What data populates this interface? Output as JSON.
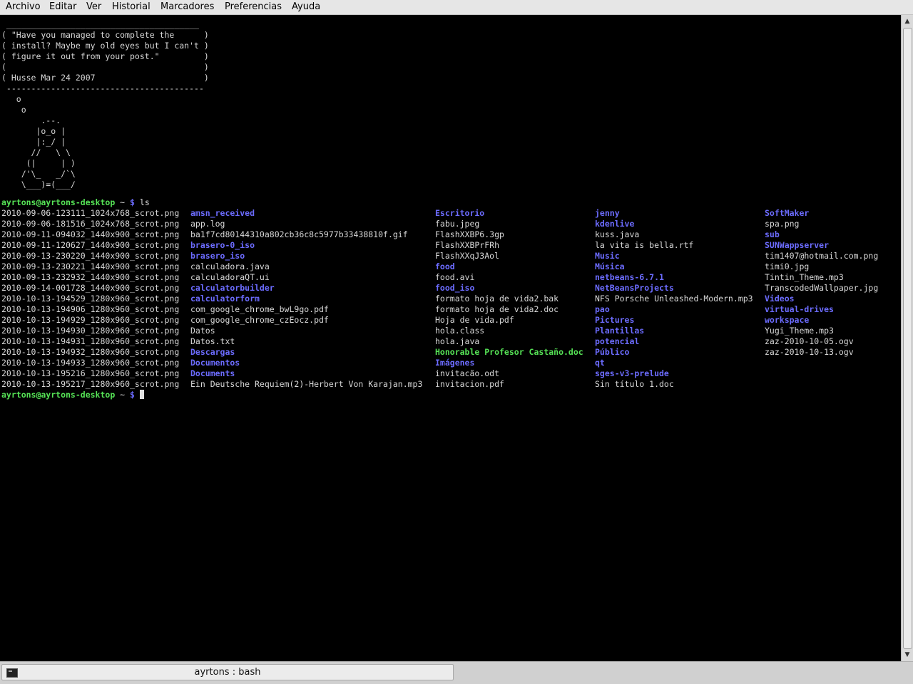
{
  "menubar": {
    "items": [
      "Archivo",
      "Editar",
      "Ver",
      "Historial",
      "Marcadores",
      "Preferencias",
      "Ayuda"
    ]
  },
  "terminal": {
    "cowsay_lines": [
      " _______________________________________",
      "( \"Have you managed to complete the      )",
      "( install? Maybe my old eyes but I can't )",
      "( figure it out from your post.\"         )",
      "(                                        )",
      "( Husse Mar 24 2007                      )",
      " ----------------------------------------",
      "   o",
      "    o",
      "        .--.",
      "       |o_o |",
      "       |:_/ |",
      "      //   \\ \\",
      "     (|     | )",
      "    /'\\_   _/`\\",
      "    \\___)=(___/"
    ],
    "prompt": {
      "user_host": "ayrtons@ayrtons-desktop",
      "path": " ~ ",
      "symbol": "$",
      "command": " ls"
    },
    "ls_columns": [
      [
        {
          "n": "2010-09-06-123111_1024x768_scrot.png",
          "t": "file"
        },
        {
          "n": "2010-09-06-181516_1024x768_scrot.png",
          "t": "file"
        },
        {
          "n": "2010-09-11-094032_1440x900_scrot.png",
          "t": "file"
        },
        {
          "n": "2010-09-11-120627_1440x900_scrot.png",
          "t": "file"
        },
        {
          "n": "2010-09-13-230220_1440x900_scrot.png",
          "t": "file"
        },
        {
          "n": "2010-09-13-230221_1440x900_scrot.png",
          "t": "file"
        },
        {
          "n": "2010-09-13-232932_1440x900_scrot.png",
          "t": "file"
        },
        {
          "n": "2010-09-14-001728_1440x900_scrot.png",
          "t": "file"
        },
        {
          "n": "2010-10-13-194529_1280x960_scrot.png",
          "t": "file"
        },
        {
          "n": "2010-10-13-194906_1280x960_scrot.png",
          "t": "file"
        },
        {
          "n": "2010-10-13-194929_1280x960_scrot.png",
          "t": "file"
        },
        {
          "n": "2010-10-13-194930_1280x960_scrot.png",
          "t": "file"
        },
        {
          "n": "2010-10-13-194931_1280x960_scrot.png",
          "t": "file"
        },
        {
          "n": "2010-10-13-194932_1280x960_scrot.png",
          "t": "file"
        },
        {
          "n": "2010-10-13-194933_1280x960_scrot.png",
          "t": "file"
        },
        {
          "n": "2010-10-13-195216_1280x960_scrot.png",
          "t": "file"
        },
        {
          "n": "2010-10-13-195217_1280x960_scrot.png",
          "t": "file"
        }
      ],
      [
        {
          "n": "amsn_received",
          "t": "dir"
        },
        {
          "n": "app.log",
          "t": "file"
        },
        {
          "n": "ba1f7cd80144310a802cb36c8c5977b33438810f.gif",
          "t": "file"
        },
        {
          "n": "brasero-0_iso",
          "t": "dir"
        },
        {
          "n": "brasero_iso",
          "t": "dir"
        },
        {
          "n": "calculadora.java",
          "t": "file"
        },
        {
          "n": "calculadoraQT.ui",
          "t": "file"
        },
        {
          "n": "calculatorbuilder",
          "t": "dir"
        },
        {
          "n": "calculatorform",
          "t": "dir"
        },
        {
          "n": "com_google_chrome_bwL9go.pdf",
          "t": "file"
        },
        {
          "n": "com_google_chrome_czEocz.pdf",
          "t": "file"
        },
        {
          "n": "Datos",
          "t": "file"
        },
        {
          "n": "Datos.txt",
          "t": "file"
        },
        {
          "n": "Descargas",
          "t": "dir"
        },
        {
          "n": "Documentos",
          "t": "dir"
        },
        {
          "n": "Documents",
          "t": "dir"
        },
        {
          "n": "Ein Deutsche Requiem(2)-Herbert Von Karajan.mp3",
          "t": "file"
        }
      ],
      [
        {
          "n": "Escritorio",
          "t": "dir"
        },
        {
          "n": "fabu.jpeg",
          "t": "file"
        },
        {
          "n": "FlashXXBP6.3gp",
          "t": "file"
        },
        {
          "n": "FlashXXBPrFRh",
          "t": "file"
        },
        {
          "n": "FlashXXqJ3Aol",
          "t": "file"
        },
        {
          "n": "food",
          "t": "dir"
        },
        {
          "n": "food.avi",
          "t": "file"
        },
        {
          "n": "food_iso",
          "t": "dir"
        },
        {
          "n": "formato hoja de vida2.bak",
          "t": "file"
        },
        {
          "n": "formato hoja de vida2.doc",
          "t": "file"
        },
        {
          "n": "Hoja de vida.pdf",
          "t": "file"
        },
        {
          "n": "hola.class",
          "t": "file"
        },
        {
          "n": "hola.java",
          "t": "file"
        },
        {
          "n": "Honorable Profesor Castaño.doc",
          "t": "exe"
        },
        {
          "n": "Imágenes",
          "t": "dir"
        },
        {
          "n": "invitacão.odt",
          "t": "file"
        },
        {
          "n": "invitacion.pdf",
          "t": "file"
        }
      ],
      [
        {
          "n": "jenny",
          "t": "dir"
        },
        {
          "n": "kdenlive",
          "t": "dir"
        },
        {
          "n": "kuss.java",
          "t": "file"
        },
        {
          "n": "la vita is bella.rtf",
          "t": "file"
        },
        {
          "n": "Music",
          "t": "dir"
        },
        {
          "n": "Música",
          "t": "dir"
        },
        {
          "n": "netbeans-6.7.1",
          "t": "dir"
        },
        {
          "n": "NetBeansProjects",
          "t": "dir"
        },
        {
          "n": "NFS Porsche Unleashed-Modern.mp3",
          "t": "file"
        },
        {
          "n": "pao",
          "t": "dir"
        },
        {
          "n": "Pictures",
          "t": "dir"
        },
        {
          "n": "Plantillas",
          "t": "dir"
        },
        {
          "n": "potencial",
          "t": "dir"
        },
        {
          "n": "Público",
          "t": "dir"
        },
        {
          "n": "qt",
          "t": "dir"
        },
        {
          "n": "sges-v3-prelude",
          "t": "dir"
        },
        {
          "n": "Sin título 1.doc",
          "t": "file"
        }
      ],
      [
        {
          "n": "SoftMaker",
          "t": "dir"
        },
        {
          "n": "spa.png",
          "t": "file"
        },
        {
          "n": "sub",
          "t": "dir"
        },
        {
          "n": "SUNWappserver",
          "t": "dir"
        },
        {
          "n": "tim1407@hotmail.com.png",
          "t": "file"
        },
        {
          "n": "timi0.jpg",
          "t": "file"
        },
        {
          "n": "Tintin_Theme.mp3",
          "t": "file"
        },
        {
          "n": "TranscodedWallpaper.jpg",
          "t": "file"
        },
        {
          "n": "Videos",
          "t": "dir"
        },
        {
          "n": "virtual-drives",
          "t": "dir"
        },
        {
          "n": "workspace",
          "t": "dir"
        },
        {
          "n": "Yugi_Theme.mp3",
          "t": "file"
        },
        {
          "n": "zaz-2010-10-05.ogv",
          "t": "file"
        },
        {
          "n": "zaz-2010-10-13.ogv",
          "t": "file"
        }
      ]
    ]
  },
  "scrollbar": {
    "up_icon": "triangle-up",
    "down_icon": "triangle-down"
  },
  "taskbar": {
    "task_label": "ayrtons : bash",
    "task_icon": "terminal-icon"
  },
  "colors": {
    "directory": "#6c6cff",
    "executable": "#56e356",
    "prompt_user": "#56e356",
    "terminal_bg": "#000000"
  }
}
